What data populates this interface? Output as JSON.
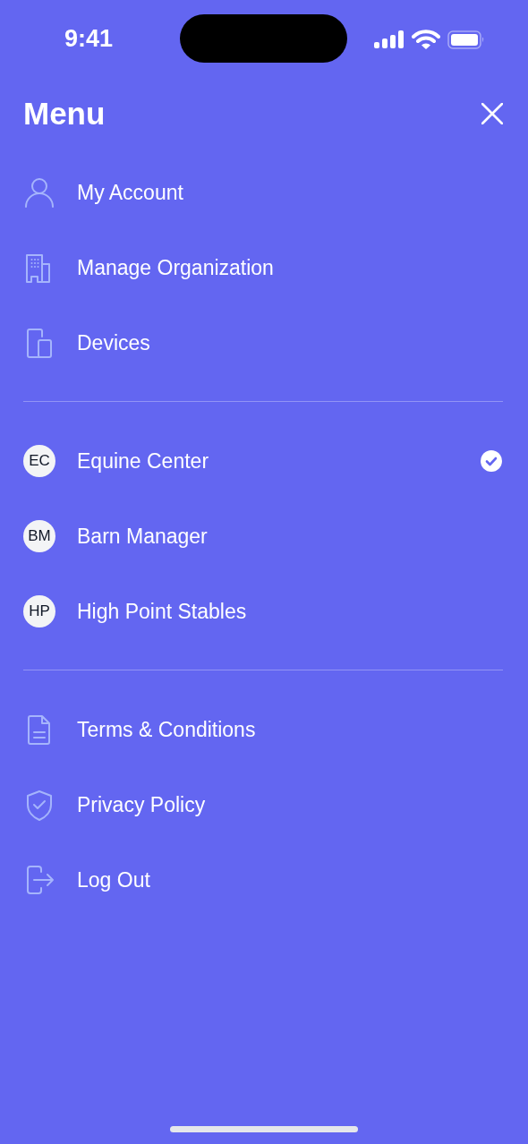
{
  "status_bar": {
    "time": "9:41"
  },
  "header": {
    "title": "Menu"
  },
  "sections": [
    {
      "kind": "links",
      "items": [
        {
          "label": "My Account"
        },
        {
          "label": "Manage Organization"
        },
        {
          "label": "Devices"
        }
      ]
    },
    {
      "kind": "organizations",
      "items": [
        {
          "initials": "EC",
          "label": "Equine Center",
          "selected": true
        },
        {
          "initials": "BM",
          "label": "Barn Manager",
          "selected": false
        },
        {
          "initials": "HP",
          "label": "High Point Stables",
          "selected": false
        }
      ]
    },
    {
      "kind": "links",
      "items": [
        {
          "label": "Terms & Conditions"
        },
        {
          "label": "Privacy Policy"
        },
        {
          "label": "Log Out"
        }
      ]
    }
  ]
}
